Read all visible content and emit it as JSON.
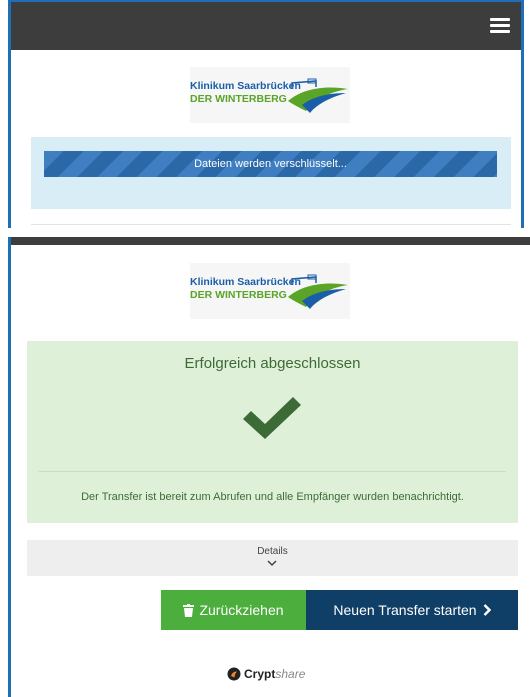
{
  "logo": {
    "line1": "Klinikum Saarbrücken",
    "line2": "DER WINTERBERG"
  },
  "top_panel": {
    "progress_label": "Dateien werden verschlüsselt..."
  },
  "bottom_panel": {
    "success_title": "Erfolgreich abgeschlossen",
    "success_message": "Der Transfer ist bereit zum Abrufen und alle Empfänger wurden benachrichtigt.",
    "details_label": "Details",
    "withdraw_button": "Zurückziehen",
    "new_transfer_button": "Neuen Transfer starten"
  },
  "footer": {
    "brand_bold": "Crypt",
    "brand_light": "share"
  },
  "colors": {
    "topbar": "#3d3d3d",
    "progress_bg": "#d9edf7",
    "success_bg": "#dff0d8",
    "success_text": "#3c6b37",
    "withdraw_button": "#4cae3c",
    "new_transfer_button": "#0f3f66"
  },
  "icons": {
    "menu": "hamburger-icon",
    "success": "checkmark-icon",
    "details": "chevron-down-icon",
    "withdraw": "trash-icon",
    "new_transfer": "chevron-right-icon"
  }
}
